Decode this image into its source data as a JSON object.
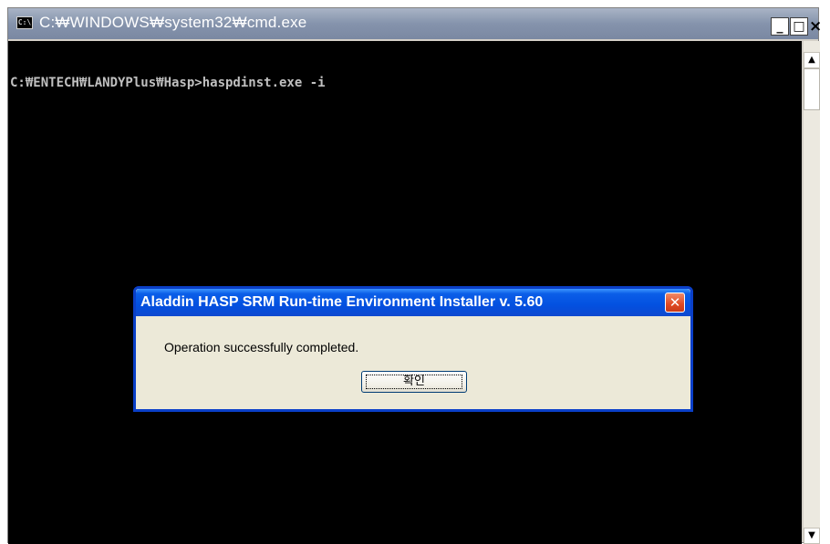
{
  "cmd_window": {
    "title": "C:₩WINDOWS₩system32₩cmd.exe",
    "icon_text": "C:\\",
    "controls": {
      "minimize": "_",
      "maximize": "□",
      "close": "×"
    },
    "console_line": "C:₩ENTECH₩LANDYPlus₩Hasp>haspdinst.exe -i"
  },
  "scrollbar": {
    "up_arrow": "▲",
    "down_arrow": "▼"
  },
  "dialog": {
    "title": "Aladdin HASP SRM Run-time Environment Installer v. 5.60",
    "close_label": "✕",
    "message": "Operation successfully completed.",
    "ok_label": "확인"
  }
}
